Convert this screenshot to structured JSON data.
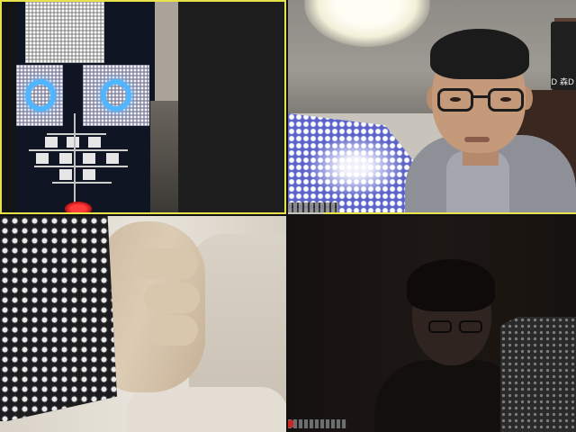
{
  "app": {
    "layout": "gallery-view",
    "tiles": 4
  },
  "participants": [
    {
      "name_label": "",
      "active_speaker": true,
      "highlight_color": "#e8e24a"
    },
    {
      "name_label": "D 森D",
      "active_speaker": false
    },
    {
      "name_label": "",
      "active_speaker": false
    },
    {
      "name_label": "",
      "active_speaker": false
    }
  ],
  "colors": {
    "active_border": "#e8e24a",
    "led_blue": "#4fb6ff",
    "name_tag_bg": "#1f1f1f"
  }
}
